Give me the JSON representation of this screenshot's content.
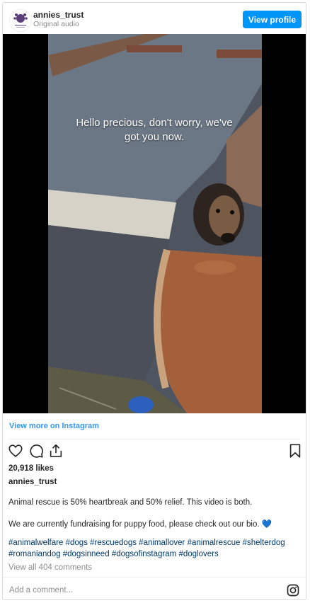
{
  "header": {
    "username": "annies_trust",
    "subtitle": "Original audio",
    "view_profile_label": "View profile",
    "avatar_icon": "paw-logo-avatar"
  },
  "video": {
    "caption_line1": "Hello precious, don't worry, we've",
    "caption_line2": "got you now."
  },
  "view_more_label": "View more on Instagram",
  "actions": {
    "like_icon": "heart-icon",
    "comment_icon": "comment-icon",
    "share_icon": "share-icon",
    "save_icon": "bookmark-icon"
  },
  "likes": "20,918 likes",
  "owner": "annies_trust",
  "post_text": {
    "line1": "Animal rescue is 50% heartbreak and 50% relief. This video is both.",
    "line2": "We are currently fundraising for puppy food, please check out our bio. 💙"
  },
  "hashtags": [
    "#animalwelfare",
    "#dogs",
    "#rescuedogs",
    "#animallover",
    "#animalrescue",
    "#shelterdog",
    "#romaniandog",
    "#dogsinneed",
    "#dogsofinstagram",
    "#doglovers"
  ],
  "view_all_comments": "View all 404 comments",
  "comment": {
    "placeholder": "Add a comment...",
    "value": ""
  },
  "colors": {
    "accent": "#0095f6",
    "link": "#3897f0",
    "hashtag": "#00376b",
    "muted": "#8e8e8e"
  }
}
